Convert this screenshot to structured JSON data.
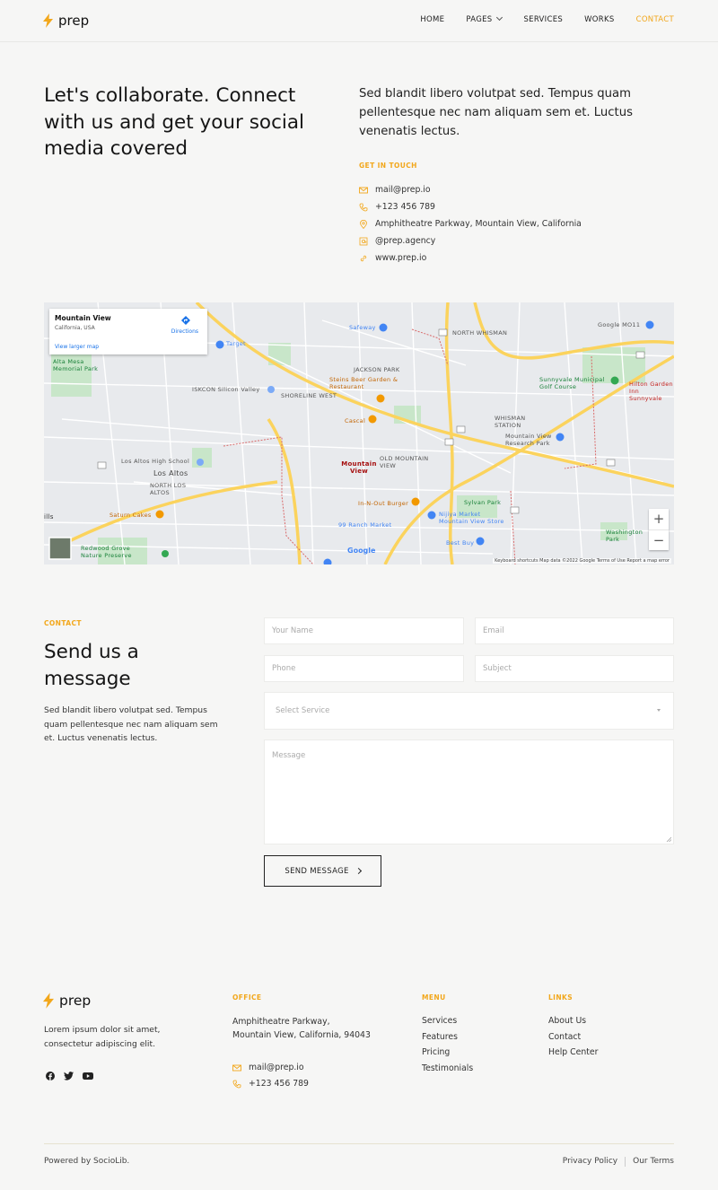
{
  "brand": {
    "name": "prep",
    "accent": "#f2a71b"
  },
  "nav": {
    "items": [
      {
        "label": "HOME"
      },
      {
        "label": "PAGES"
      },
      {
        "label": "SERVICES"
      },
      {
        "label": "WORKS"
      },
      {
        "label": "CONTACT"
      }
    ]
  },
  "hero": {
    "title": "Let's collaborate. Connect with us and get your social media covered",
    "description": "Sed blandit libero volutpat sed. Tempus quam pellentesque nec nam aliquam sem et. Luctus venenatis lectus."
  },
  "get_in_touch": {
    "heading": "GET IN TOUCH",
    "items": [
      {
        "icon": "mail-icon",
        "text": "mail@prep.io"
      },
      {
        "icon": "phone-icon",
        "text": "+123 456 789"
      },
      {
        "icon": "location-icon",
        "text": "Amphitheatre Parkway, Mountain View, California"
      },
      {
        "icon": "at-icon",
        "text": "@prep.agency"
      },
      {
        "icon": "link-icon",
        "text": "www.prep.io"
      }
    ]
  },
  "map": {
    "card_title": "Mountain View",
    "card_subtitle": "California, USA",
    "larger_map": "View larger map",
    "directions": "Directions",
    "zoom_in": "+",
    "zoom_out": "−",
    "attribution": "Keyboard shortcuts   Map data ©2022 Google   Terms of Use   Report a map error",
    "google": "Google",
    "labels": {
      "north_whisman": "NORTH WHISMAN",
      "jackson_park": "JACKSON PARK",
      "shoreline_west": "SHORELINE WEST",
      "whisman_station": "WHISMAN STATION",
      "old_mountain_view": "OLD MOUNTAIN VIEW",
      "los_altos": "Los Altos",
      "north_los_altos": "NORTH LOS ALTOS",
      "mountain_view": "Mountain View",
      "safeway": "Safeway",
      "target": "Target",
      "steins": "Steins Beer Garden & Restaurant",
      "cascal": "Cascal",
      "iskcon": "ISKCON Silicon Valley",
      "alta_mesa": "Alta Mesa Memorial Park",
      "la_high": "Los Altos High School",
      "saturn": "Saturn Cakes",
      "redwood": "Redwood Grove Nature Preserve",
      "innout": "In-N-Out Burger",
      "ranch": "99 Ranch Market",
      "nijiya": "Nijiya Market Mountain View Store",
      "sylvan": "Sylvan Park",
      "bestbuy": "Best Buy",
      "mv_research": "Mountain View Research Park",
      "sunnyvale_golf": "Sunnyvale Municipal Golf Course",
      "hilton": "Hilton Garden Inn Sunnyvale",
      "google_mo": "Google MO11",
      "washington": "Washington Park",
      "hills": "ills"
    }
  },
  "contact_form": {
    "eyebrow": "CONTACT",
    "title": "Send us a message",
    "description": "Sed blandit libero volutpat sed. Tempus quam pellentesque nec nam aliquam sem et. Luctus venenatis lectus.",
    "name_placeholder": "Your Name",
    "email_placeholder": "Email",
    "phone_placeholder": "Phone",
    "subject_placeholder": "Subject",
    "service_placeholder": "Select Service",
    "message_placeholder": "Message",
    "submit_label": "SEND MESSAGE"
  },
  "footer": {
    "description": "Lorem ipsum dolor sit amet, consectetur adipiscing elit.",
    "office": {
      "heading": "OFFICE",
      "address_line1": "Amphitheatre Parkway,",
      "address_line2": "Mountain View, California, 94043",
      "email": "mail@prep.io",
      "phone": "+123 456 789"
    },
    "menu": {
      "heading": "MENU",
      "items": [
        {
          "label": "Services"
        },
        {
          "label": "Features"
        },
        {
          "label": "Pricing"
        },
        {
          "label": "Testimonials"
        }
      ]
    },
    "links": {
      "heading": "LINKS",
      "items": [
        {
          "label": "About Us"
        },
        {
          "label": "Contact"
        },
        {
          "label": "Help Center"
        }
      ]
    },
    "powered_by": "Powered by SocioLib.",
    "privacy": "Privacy Policy",
    "terms": "Our Terms"
  }
}
